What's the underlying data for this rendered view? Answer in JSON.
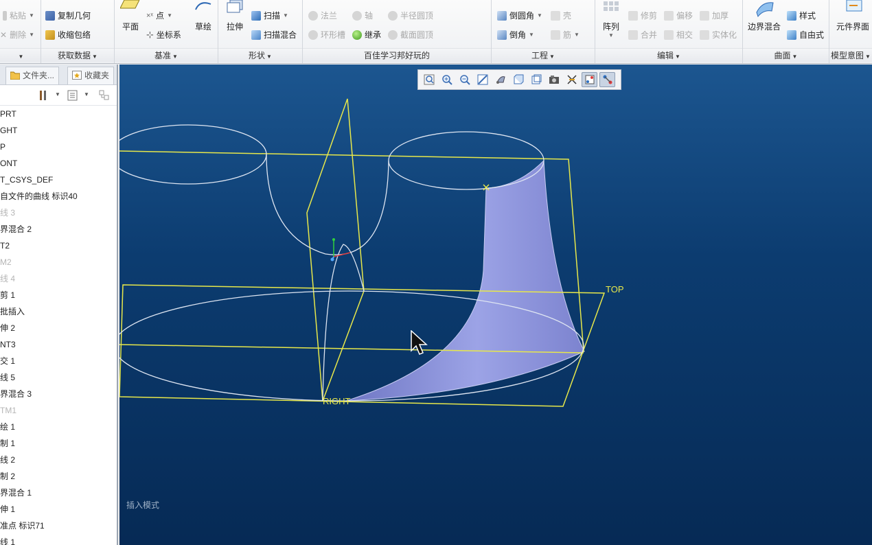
{
  "ribbon": {
    "groups": [
      {
        "id": "clipboard",
        "label": "",
        "items": [
          {
            "label": "粘贴",
            "enabled": false
          },
          {
            "label": "删除",
            "enabled": false
          }
        ]
      },
      {
        "id": "get_data",
        "label": "获取数据",
        "items": [
          {
            "label": "复制几何",
            "enabled": true
          },
          {
            "label": "收缩包络",
            "enabled": true
          }
        ]
      },
      {
        "id": "datum",
        "label": "基准",
        "big": [
          {
            "label": "平面"
          },
          {
            "label": "草绘"
          }
        ],
        "items": [
          {
            "label": "点",
            "enabled": true
          },
          {
            "label": "坐标系",
            "enabled": true
          }
        ]
      },
      {
        "id": "shapes",
        "label": "形状",
        "big": [
          {
            "label": "拉伸"
          }
        ],
        "items": [
          {
            "label": "扫描",
            "enabled": true
          },
          {
            "label": "扫描混合",
            "enabled": true
          }
        ]
      },
      {
        "id": "custom",
        "label": "百佳学习邦好玩的",
        "items": [
          {
            "label": "法兰",
            "enabled": false
          },
          {
            "label": "轴",
            "enabled": false
          },
          {
            "label": "半径圆顶",
            "enabled": false
          },
          {
            "label": "环形槽",
            "enabled": false
          },
          {
            "label": "继承",
            "enabled": true
          },
          {
            "label": "截面圆顶",
            "enabled": false
          }
        ]
      },
      {
        "id": "engineering",
        "label": "工程",
        "items": [
          {
            "label": "倒圆角",
            "enabled": true
          },
          {
            "label": "壳",
            "enabled": false
          },
          {
            "label": "倒角",
            "enabled": true
          },
          {
            "label": "筋",
            "enabled": false
          }
        ]
      },
      {
        "id": "editing",
        "label": "编辑",
        "big": [
          {
            "label": "阵列"
          }
        ],
        "items": [
          {
            "label": "修剪",
            "enabled": false
          },
          {
            "label": "偏移",
            "enabled": false
          },
          {
            "label": "加厚",
            "enabled": false
          },
          {
            "label": "合并",
            "enabled": false
          },
          {
            "label": "相交",
            "enabled": false
          },
          {
            "label": "实体化",
            "enabled": false
          }
        ]
      },
      {
        "id": "surfaces",
        "label": "曲面",
        "big": [
          {
            "label": "边界混合"
          }
        ],
        "items": [
          {
            "label": "样式",
            "enabled": true
          },
          {
            "label": "自由式",
            "enabled": true
          }
        ]
      },
      {
        "id": "model_intent",
        "label": "模型意图",
        "big": [
          {
            "label": "元件界面"
          }
        ]
      }
    ]
  },
  "left_panel": {
    "tabs": [
      {
        "label": "文件夹..."
      },
      {
        "label": "收藏夹"
      }
    ],
    "tree": [
      {
        "label": "PRT",
        "dim": false
      },
      {
        "label": "GHT",
        "dim": false
      },
      {
        "label": "P",
        "dim": false
      },
      {
        "label": "ONT",
        "dim": false
      },
      {
        "label": "T_CSYS_DEF",
        "dim": false
      },
      {
        "label": "自文件的曲线 标识40",
        "dim": false
      },
      {
        "label": "线 3",
        "dim": true
      },
      {
        "label": "界混合 2",
        "dim": false
      },
      {
        "label": "T2",
        "dim": false
      },
      {
        "label": "M2",
        "dim": true
      },
      {
        "label": "线 4",
        "dim": true
      },
      {
        "label": "剪 1",
        "dim": false
      },
      {
        "label": "批插入",
        "dim": false
      },
      {
        "label": "伸 2",
        "dim": false
      },
      {
        "label": "NT3",
        "dim": false
      },
      {
        "label": "交 1",
        "dim": false
      },
      {
        "label": "线 5",
        "dim": false
      },
      {
        "label": "界混合 3",
        "dim": false
      },
      {
        "label": "TM1",
        "dim": true
      },
      {
        "label": "绘 1",
        "dim": false
      },
      {
        "label": "制 1",
        "dim": false
      },
      {
        "label": "线 2",
        "dim": false
      },
      {
        "label": "制 2",
        "dim": false
      },
      {
        "label": "界混合 1",
        "dim": false
      },
      {
        "label": "伸 1",
        "dim": false
      },
      {
        "label": "准点 标识71",
        "dim": false
      },
      {
        "label": "线 1",
        "dim": false
      }
    ]
  },
  "viewport": {
    "mode_text": "插入模式",
    "plane_labels": {
      "top": "TOP",
      "right": "RIGHT"
    },
    "toolbar_icons": [
      "refit-icon",
      "zoom-in-icon",
      "zoom-out-icon",
      "repaint-icon",
      "display-style-icon",
      "saved-orientations-icon",
      "named-views-icon",
      "view-manager-icon",
      "datum-display-icon",
      "spin-center-icon",
      "annotation-display-icon"
    ]
  },
  "colors": {
    "viewport_top": "#1c5690",
    "viewport_bottom": "#062a55",
    "datum_plane": "#e8e84a",
    "surface": "#8f96dc"
  }
}
